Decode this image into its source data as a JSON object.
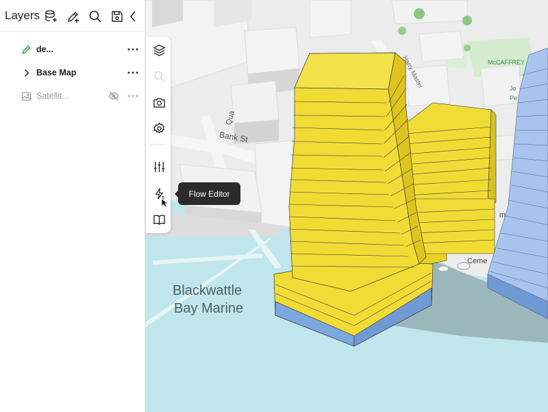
{
  "panel": {
    "title": "Layers",
    "header_icons": [
      "add-database-icon",
      "edit-plus-icon",
      "search-icon",
      "save-icon",
      "chevron-left-icon"
    ]
  },
  "layers": [
    {
      "name": "de...",
      "icon": "pencil-icon",
      "icon_color": "#2e9e47",
      "visible": true
    },
    {
      "name": "Base Map",
      "icon": "chevron-right-icon",
      "visible": true
    },
    {
      "name": "Satellit...",
      "icon": "image-icon",
      "visible": false
    }
  ],
  "toolbar": {
    "items": [
      "layers-icon",
      "disabled-search-icon",
      "camera-icon",
      "settings-icon",
      "sliders-icon",
      "flow-icon",
      "book-icon"
    ],
    "tooltip": "Flow Editor"
  },
  "map": {
    "labels": {
      "bank_st": "Bank St",
      "bay_line1": "Blackwattle",
      "bay_line2": "Bay Marine",
      "quay": "Qua",
      "harry_master": "Harry Master",
      "mccaffrey": "McCAFFREY",
      "jo": "Jo",
      "pe": "Pe",
      "ceme": "Ceme",
      "em": "m"
    },
    "colors": {
      "water": "#bfe6ec",
      "tower": "#f1dc36",
      "tower_side": "#e4cc20",
      "podium_blue": "#7aa8df",
      "neighbor_blue": "#a9c4ef"
    }
  }
}
